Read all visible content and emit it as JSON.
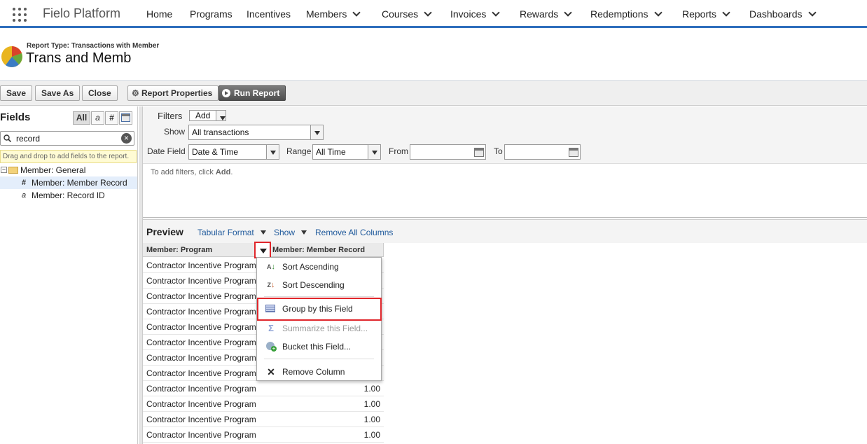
{
  "app": {
    "name": "Fielo Platform",
    "nav": [
      {
        "label": "Home",
        "has_menu": false
      },
      {
        "label": "Programs",
        "has_menu": false
      },
      {
        "label": "Incentives",
        "has_menu": false
      },
      {
        "label": "Members",
        "has_menu": true
      },
      {
        "label": "Courses",
        "has_menu": true
      },
      {
        "label": "Invoices",
        "has_menu": true
      },
      {
        "label": "Rewards",
        "has_menu": true
      },
      {
        "label": "Redemptions",
        "has_menu": true
      },
      {
        "label": "Reports",
        "has_menu": true
      },
      {
        "label": "Dashboards",
        "has_menu": true
      }
    ]
  },
  "report": {
    "type_label": "Report Type: Transactions with Member",
    "name": "Trans and Memb"
  },
  "toolbar": {
    "save": "Save",
    "save_as": "Save As",
    "close": "Close",
    "properties": "Report Properties",
    "run": "Run Report"
  },
  "fields": {
    "title": "Fields",
    "filter_types": [
      "All",
      "a",
      "#",
      "cal"
    ],
    "search_value": "record",
    "hint": "Drag and drop to add fields to the report.",
    "tree": [
      {
        "label": "Member: General",
        "kind": "folder"
      },
      {
        "label": "Member: Member Record",
        "kind": "number"
      },
      {
        "label": "Member: Record ID",
        "kind": "text"
      }
    ]
  },
  "filters": {
    "filters_label": "Filters",
    "add_label": "Add",
    "show_label": "Show",
    "show_value": "All transactions",
    "date_field_label": "Date Field",
    "date_field_value": "Date & Time",
    "range_label": "Range",
    "range_value": "All Time",
    "from_label": "From",
    "to_label": "To",
    "hint_prefix": "To add filters, click ",
    "hint_action": "Add",
    "hint_suffix": "."
  },
  "preview": {
    "title": "Preview",
    "format": "Tabular Format",
    "show": "Show",
    "remove_all": "Remove All Columns",
    "columns": [
      "Member: Program",
      "Member: Member Record"
    ],
    "rows": [
      {
        "program": "Contractor Incentive Program",
        "record": ""
      },
      {
        "program": "Contractor Incentive Program",
        "record": ""
      },
      {
        "program": "Contractor Incentive Program",
        "record": ""
      },
      {
        "program": "Contractor Incentive Program",
        "record": ""
      },
      {
        "program": "Contractor Incentive Program",
        "record": ""
      },
      {
        "program": "Contractor Incentive Program",
        "record": ""
      },
      {
        "program": "Contractor Incentive Program",
        "record": ""
      },
      {
        "program": "Contractor Incentive Program",
        "record": ""
      },
      {
        "program": "Contractor Incentive Program",
        "record": "1.00"
      },
      {
        "program": "Contractor Incentive Program",
        "record": "1.00"
      },
      {
        "program": "Contractor Incentive Program",
        "record": "1.00"
      },
      {
        "program": "Contractor Incentive Program",
        "record": "1.00"
      }
    ]
  },
  "column_menu": {
    "sort_asc": "Sort Ascending",
    "sort_desc": "Sort Descending",
    "group": "Group by this Field",
    "summarize": "Summarize this Field...",
    "bucket": "Bucket this Field...",
    "remove": "Remove Column"
  },
  "colors": {
    "nav_accent": "#2f6fbd",
    "highlight_red": "#e0262b",
    "link_blue": "#205a9c"
  }
}
